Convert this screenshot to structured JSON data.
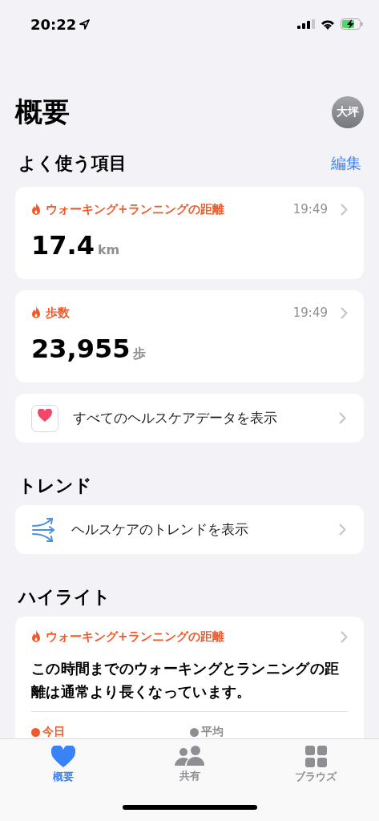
{
  "status_bar": {
    "time": "20:22"
  },
  "header": {
    "title": "概要",
    "avatar": "大坪"
  },
  "favorites": {
    "title": "よく使う項目",
    "edit": "編集",
    "items": [
      {
        "kind": "metric",
        "label": "ウォーキング+ランニングの距離",
        "time": "19:49",
        "value": "17.4",
        "unit": "km"
      },
      {
        "kind": "metric",
        "label": "歩数",
        "time": "19:49",
        "value": "23,955",
        "unit": "歩"
      },
      {
        "kind": "link",
        "label": "すべてのヘルスケアデータを表示"
      }
    ]
  },
  "trends": {
    "title": "トレンド",
    "link": "ヘルスケアのトレンドを表示"
  },
  "highlights": {
    "title": "ハイライト",
    "card": {
      "label": "ウォーキング+ランニングの距離",
      "text": "この時間までのウォーキングとランニングの距離は通常より長くなっています。",
      "legend": [
        {
          "label": "今日",
          "color": "#f05a28"
        },
        {
          "label": "平均",
          "color": "#8e8e93"
        }
      ]
    }
  },
  "tab_bar": [
    {
      "label": "概要",
      "selected": true
    },
    {
      "label": "共有",
      "selected": false
    },
    {
      "label": "ブラウズ",
      "selected": false
    }
  ]
}
